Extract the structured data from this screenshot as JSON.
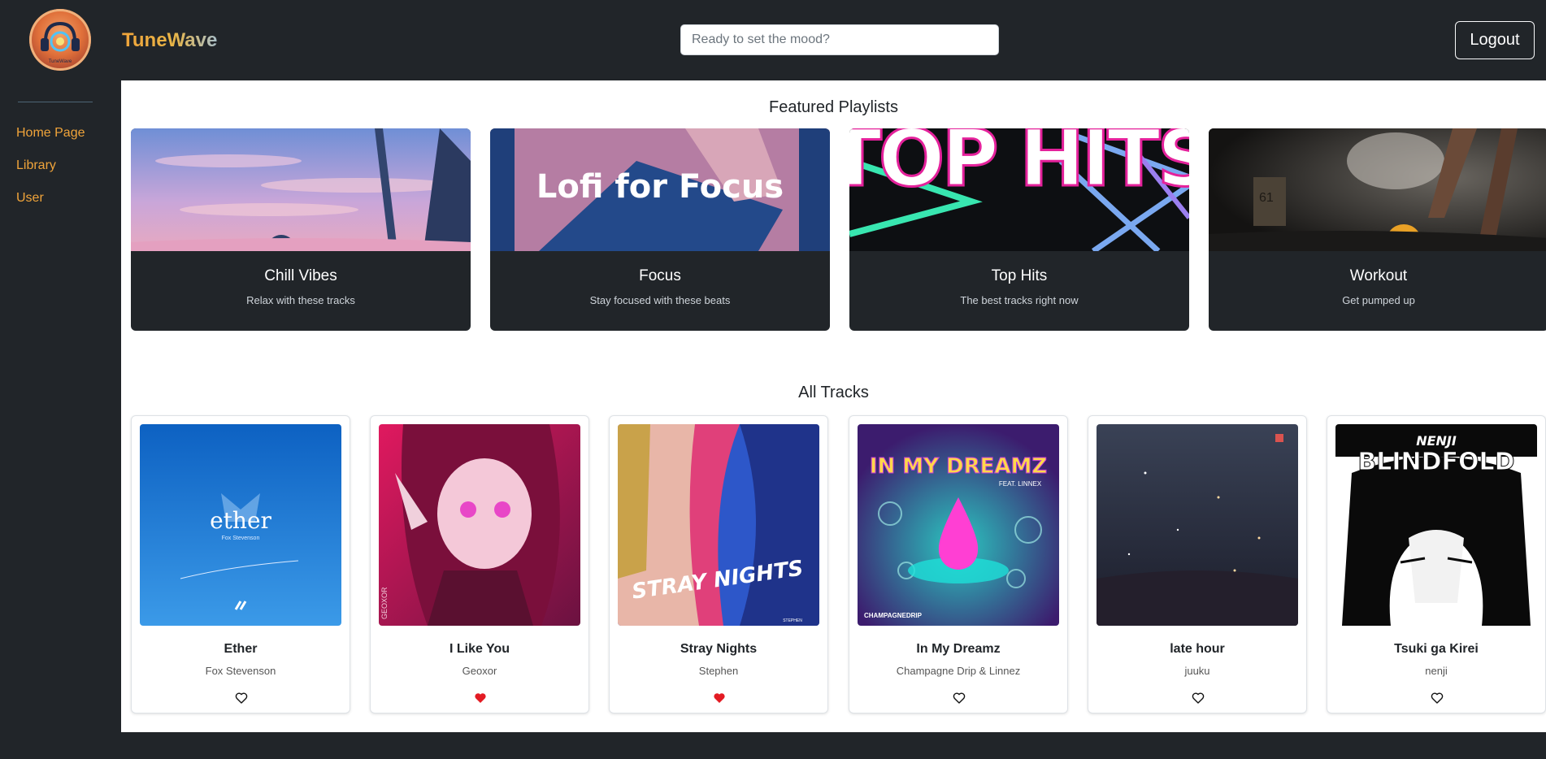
{
  "app": {
    "brand": "TuneWave",
    "logo_caption": "TuneWave"
  },
  "search": {
    "placeholder": "Ready to set the mood?",
    "value": ""
  },
  "header": {
    "logout_label": "Logout"
  },
  "sidebar": {
    "items": [
      {
        "label": "Home Page"
      },
      {
        "label": "Library"
      },
      {
        "label": "User"
      }
    ]
  },
  "featured": {
    "title": "Featured Playlists",
    "playlists": [
      {
        "title": "Chill Vibes",
        "description": "Relax with these tracks",
        "image_text": ""
      },
      {
        "title": "Focus",
        "description": "Stay focused with these beats",
        "image_text": "Lofi for Focus"
      },
      {
        "title": "Top Hits",
        "description": "The best tracks right now",
        "image_text": "TOP HITS"
      },
      {
        "title": "Workout",
        "description": "Get pumped up",
        "image_text": "61"
      }
    ]
  },
  "tracks": {
    "title": "All Tracks",
    "items": [
      {
        "title": "Ether",
        "artist": "Fox Stevenson",
        "liked": false,
        "art_text": "ether",
        "art_subtext": "Fox Stevenson"
      },
      {
        "title": "I Like You",
        "artist": "Geoxor",
        "liked": true,
        "art_text": "GEOXOR",
        "art_subtext": ""
      },
      {
        "title": "Stray Nights",
        "artist": "Stephen",
        "liked": true,
        "art_text": "STRAY NIGHTS",
        "art_subtext": "STEPHEN"
      },
      {
        "title": "In My Dreamz",
        "artist": "Champagne Drip & Linnez",
        "liked": false,
        "art_text": "IN MY DREAMZ",
        "art_subtext": "FEAT. LINNEX",
        "art_footer": "CHAMPAGNEDRIP"
      },
      {
        "title": "late hour",
        "artist": "juuku",
        "liked": false,
        "art_text": "",
        "art_subtext": ""
      },
      {
        "title": "Tsuki ga Kirei",
        "artist": "nenji",
        "liked": false,
        "art_text": "BLINDFOLD",
        "art_subtext": "NENJI"
      }
    ]
  },
  "colors": {
    "background_dark": "#212529",
    "accent": "#f0a43a",
    "liked_heart": "#e31b23"
  }
}
